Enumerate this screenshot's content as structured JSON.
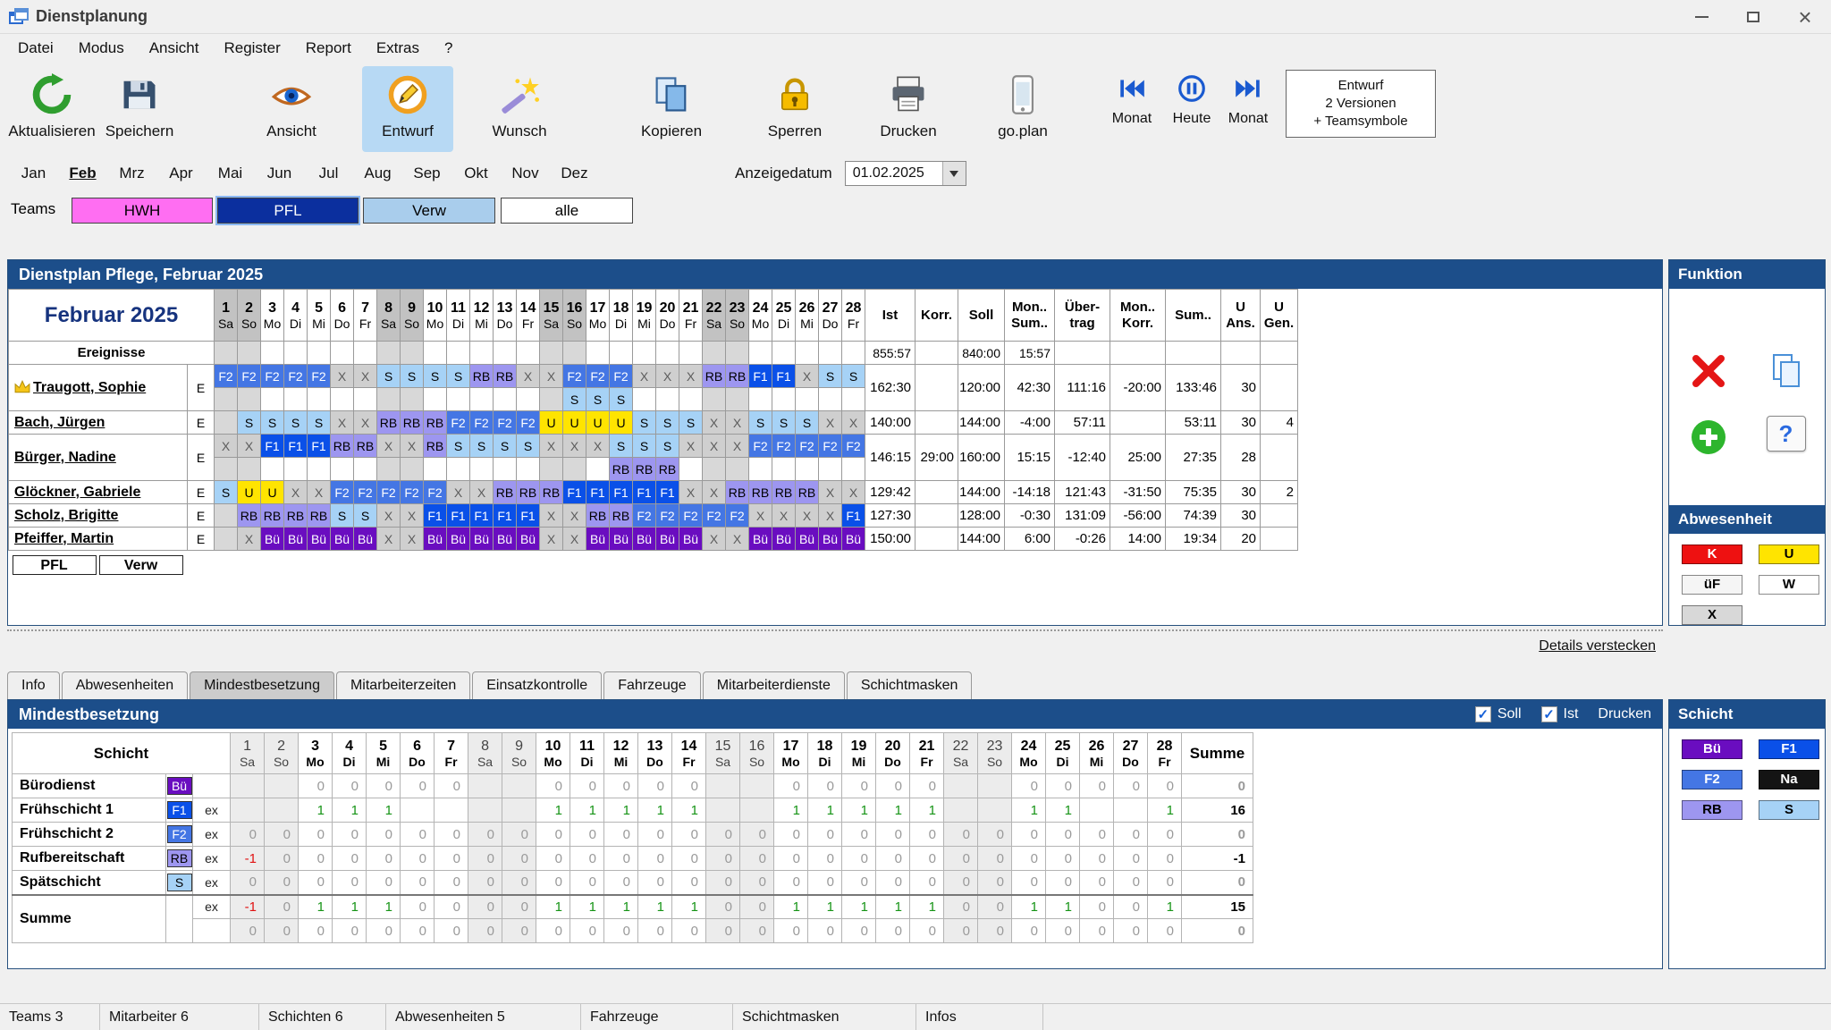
{
  "window": {
    "title": "Dienstplanung"
  },
  "menu": {
    "items": [
      "Datei",
      "Modus",
      "Ansicht",
      "Register",
      "Report",
      "Extras",
      "?"
    ]
  },
  "toolbar": {
    "buttons": [
      {
        "label": "Aktualisieren"
      },
      {
        "label": "Speichern"
      },
      {
        "label": "Ansicht"
      },
      {
        "label": "Entwurf",
        "active": true
      },
      {
        "label": "Wunsch"
      },
      {
        "label": "Kopieren"
      },
      {
        "label": "Sperren"
      },
      {
        "label": "Drucken"
      },
      {
        "label": "go.plan"
      }
    ],
    "nav": [
      {
        "label": "Monat"
      },
      {
        "label": "Heute"
      },
      {
        "label": "Monat"
      }
    ],
    "version_box": {
      "line1": "Entwurf",
      "line2": "2 Versionen",
      "line3": "+ Teamsymbole"
    }
  },
  "months": {
    "items": [
      "Jan",
      "Feb",
      "Mrz",
      "Apr",
      "Mai",
      "Jun",
      "Jul",
      "Aug",
      "Sep",
      "Okt",
      "Nov",
      "Dez"
    ],
    "active": "Feb",
    "anzeigedatum_label": "Anzeigedatum",
    "anzeigedatum_value": "01.02.2025"
  },
  "teams": {
    "label": "Teams",
    "buttons": [
      {
        "label": "HWH",
        "bg": "#ff6ef2",
        "fg": "#000000",
        "active": false
      },
      {
        "label": "PFL",
        "bg": "#0b2f9e",
        "fg": "#ffffff",
        "active": true
      },
      {
        "label": "Verw",
        "bg": "#a9cdec",
        "fg": "#000000",
        "active": false
      },
      {
        "label": "alle",
        "bg": "#ffffff",
        "fg": "#000000",
        "active": false
      }
    ]
  },
  "colors": {
    "header_blue": "#1c4e8a",
    "shift": {
      "F1": {
        "bg": "#0a50e8",
        "fg": "#ffffff"
      },
      "F2": {
        "bg": "#4476e4",
        "fg": "#ffffff"
      },
      "S": {
        "bg": "#a6d2f6",
        "fg": "#000000"
      },
      "RB": {
        "bg": "#9d96f0",
        "fg": "#000000"
      },
      "U": {
        "bg": "#ffe400",
        "fg": "#000000"
      },
      "Bü": {
        "bg": "#6a0dc0",
        "fg": "#ffffff"
      },
      "Na": {
        "bg": "#141414",
        "fg": "#ffffff"
      },
      "X": {
        "bg": "#cfcfcf",
        "fg": "#5c5c5c"
      }
    },
    "absence": {
      "K": {
        "bg": "#ee1111",
        "fg": "#ffffff"
      },
      "U": {
        "bg": "#ffe400",
        "fg": "#000000"
      },
      "üF": {
        "bg": "#f5f5f5",
        "fg": "#000000"
      },
      "W": {
        "bg": "#ffffff",
        "fg": "#000000"
      },
      "X": {
        "bg": "#d8d8d8",
        "fg": "#000000"
      }
    }
  },
  "schedule": {
    "title": "Dienstplan Pflege, Februar 2025",
    "month_label": "Februar 2025",
    "days": [
      {
        "n": "1",
        "d": "Sa"
      },
      {
        "n": "2",
        "d": "So"
      },
      {
        "n": "3",
        "d": "Mo"
      },
      {
        "n": "4",
        "d": "Di"
      },
      {
        "n": "5",
        "d": "Mi"
      },
      {
        "n": "6",
        "d": "Do"
      },
      {
        "n": "7",
        "d": "Fr"
      },
      {
        "n": "8",
        "d": "Sa"
      },
      {
        "n": "9",
        "d": "So"
      },
      {
        "n": "10",
        "d": "Mo"
      },
      {
        "n": "11",
        "d": "Di"
      },
      {
        "n": "12",
        "d": "Mi"
      },
      {
        "n": "13",
        "d": "Do"
      },
      {
        "n": "14",
        "d": "Fr"
      },
      {
        "n": "15",
        "d": "Sa"
      },
      {
        "n": "16",
        "d": "So"
      },
      {
        "n": "17",
        "d": "Mo"
      },
      {
        "n": "18",
        "d": "Di"
      },
      {
        "n": "19",
        "d": "Mi"
      },
      {
        "n": "20",
        "d": "Do"
      },
      {
        "n": "21",
        "d": "Fr"
      },
      {
        "n": "22",
        "d": "Sa"
      },
      {
        "n": "23",
        "d": "So"
      },
      {
        "n": "24",
        "d": "Mo"
      },
      {
        "n": "25",
        "d": "Di"
      },
      {
        "n": "26",
        "d": "Mi"
      },
      {
        "n": "27",
        "d": "Do"
      },
      {
        "n": "28",
        "d": "Fr"
      }
    ],
    "right_cols": [
      "Ist",
      "Korr.",
      "Soll",
      "Mon..\nSum..",
      "Über-\ntrag",
      "Mon..\nKorr.",
      "Sum..",
      "U\nAns.",
      "U\nGen."
    ],
    "ereignisse_label": "Ereignisse",
    "ereignisse_totals": [
      "855:57",
      "",
      "840:00",
      "15:57",
      "",
      "",
      "",
      "",
      ""
    ],
    "employees": [
      {
        "name": "Traugott, Sophie",
        "crown": true,
        "e": "E",
        "shifts": [
          "F2",
          "F2",
          "F2",
          "F2",
          "F2",
          "X",
          "X",
          "S",
          "S",
          "S",
          "S",
          "RB",
          "RB",
          "X",
          "X",
          "F2",
          "F2",
          "F2",
          "X",
          "X",
          "X",
          "RB",
          "RB",
          "F1",
          "F1",
          "X",
          "S",
          "S"
        ],
        "sub": [
          "",
          "",
          "",
          "",
          "",
          "",
          "",
          "",
          "",
          "",
          "",
          "",
          "",
          "",
          "",
          "S",
          "S",
          "S",
          "",
          "",
          "",
          "",
          "",
          "",
          "",
          "",
          "",
          ""
        ],
        "totals": [
          "162:30",
          "",
          "120:00",
          "42:30",
          "111:16",
          "-20:00",
          "133:46",
          "30",
          ""
        ]
      },
      {
        "name": "Bach, Jürgen",
        "crown": false,
        "e": "E",
        "shifts": [
          "",
          "S",
          "S",
          "S",
          "S",
          "X",
          "X",
          "RB",
          "RB",
          "RB",
          "F2",
          "F2",
          "F2",
          "F2",
          "U",
          "U",
          "U",
          "U",
          "S",
          "S",
          "S",
          "X",
          "X",
          "S",
          "S",
          "S",
          "X",
          "X"
        ],
        "totals": [
          "140:00",
          "",
          "144:00",
          "-4:00",
          "57:11",
          "",
          "53:11",
          "30",
          "4"
        ]
      },
      {
        "name": "Bürger, Nadine",
        "crown": false,
        "e": "E",
        "shifts": [
          "X",
          "X",
          "F1",
          "F1",
          "F1",
          "RB",
          "RB",
          "X",
          "X",
          "RB",
          "S",
          "S",
          "S",
          "S",
          "X",
          "X",
          "X",
          "S",
          "S",
          "S",
          "X",
          "X",
          "X",
          "F2",
          "F2",
          "F2",
          "F2",
          "F2"
        ],
        "sub": [
          "",
          "",
          "",
          "",
          "",
          "",
          "",
          "",
          "",
          "",
          "",
          "",
          "",
          "",
          "",
          "",
          "",
          "RB",
          "RB",
          "RB",
          "",
          "",
          "",
          "",
          "",
          "",
          "",
          ""
        ],
        "totals": [
          "146:15",
          "29:00",
          "160:00",
          "15:15",
          "-12:40",
          "25:00",
          "27:35",
          "28",
          ""
        ]
      },
      {
        "name": "Glöckner, Gabriele",
        "crown": false,
        "e": "E",
        "shifts": [
          "S",
          "U",
          "U",
          "X",
          "X",
          "F2",
          "F2",
          "F2",
          "F2",
          "F2",
          "X",
          "X",
          "RB",
          "RB",
          "RB",
          "F1",
          "F1",
          "F1",
          "F1",
          "F1",
          "X",
          "X",
          "RB",
          "RB",
          "RB",
          "RB",
          "X",
          "X"
        ],
        "totals": [
          "129:42",
          "",
          "144:00",
          "-14:18",
          "121:43",
          "-31:50",
          "75:35",
          "30",
          "2"
        ]
      },
      {
        "name": "Scholz, Brigitte",
        "crown": false,
        "e": "E",
        "shifts": [
          "",
          "RB",
          "RB",
          "RB",
          "RB",
          "S",
          "S",
          "X",
          "X",
          "F1",
          "F1",
          "F1",
          "F1",
          "F1",
          "X",
          "X",
          "RB",
          "RB",
          "F2",
          "F2",
          "F2",
          "F2",
          "F2",
          "X",
          "X",
          "X",
          "X",
          "F1"
        ],
        "totals": [
          "127:30",
          "",
          "128:00",
          "-0:30",
          "131:09",
          "-56:00",
          "74:39",
          "30",
          ""
        ]
      },
      {
        "name": "Pfeiffer, Martin",
        "crown": false,
        "e": "E",
        "shifts": [
          "",
          "X",
          "Bü",
          "Bü",
          "Bü",
          "Bü",
          "Bü",
          "X",
          "X",
          "Bü",
          "Bü",
          "Bü",
          "Bü",
          "Bü",
          "X",
          "X",
          "Bü",
          "Bü",
          "Bü",
          "Bü",
          "Bü",
          "X",
          "X",
          "Bü",
          "Bü",
          "Bü",
          "Bü",
          "Bü"
        ],
        "totals": [
          "150:00",
          "",
          "144:00",
          "6:00",
          "-0:26",
          "14:00",
          "19:34",
          "20",
          ""
        ]
      }
    ],
    "footer_buttons": [
      "PFL",
      "Verw"
    ]
  },
  "details_link": "Details verstecken",
  "tabs": {
    "items": [
      "Info",
      "Abwesenheiten",
      "Mindestbesetzung",
      "Mitarbeiterzeiten",
      "Einsatzkontrolle",
      "Fahrzeuge",
      "Mitarbeiterdienste",
      "Schichtmasken"
    ],
    "active": "Mindestbesetzung"
  },
  "mindest": {
    "title": "Mindestbesetzung",
    "soll_label": "Soll",
    "ist_label": "Ist",
    "drucken_label": "Drucken",
    "schicht_col": "Schicht",
    "summe_col": "Summe",
    "rows": [
      {
        "label": "Bürodienst",
        "badge": "Bü",
        "ex": "",
        "values": [
          "",
          "",
          "0",
          "0",
          "0",
          "0",
          "0",
          "",
          "",
          "0",
          "0",
          "0",
          "0",
          "0",
          "",
          "",
          "0",
          "0",
          "0",
          "0",
          "0",
          "",
          "",
          "0",
          "0",
          "0",
          "0",
          "0"
        ],
        "summe": "0"
      },
      {
        "label": "Frühschicht 1",
        "badge": "F1",
        "ex": "ex",
        "values": [
          "",
          "",
          "1",
          "1",
          "1",
          "",
          "",
          "",
          "",
          "1",
          "1",
          "1",
          "1",
          "1",
          "",
          "",
          "1",
          "1",
          "1",
          "1",
          "1",
          "",
          "",
          "1",
          "1",
          "",
          "",
          "1"
        ],
        "summe": "16"
      },
      {
        "label": "Frühschicht 2",
        "badge": "F2",
        "ex": "ex",
        "values": [
          "0",
          "0",
          "0",
          "0",
          "0",
          "0",
          "0",
          "0",
          "0",
          "0",
          "0",
          "0",
          "0",
          "0",
          "0",
          "0",
          "0",
          "0",
          "0",
          "0",
          "0",
          "0",
          "0",
          "0",
          "0",
          "0",
          "0",
          "0"
        ],
        "summe": "0"
      },
      {
        "label": "Rufbereitschaft",
        "badge": "RB",
        "ex": "ex",
        "values": [
          "-1",
          "0",
          "0",
          "0",
          "0",
          "0",
          "0",
          "0",
          "0",
          "0",
          "0",
          "0",
          "0",
          "0",
          "0",
          "0",
          "0",
          "0",
          "0",
          "0",
          "0",
          "0",
          "0",
          "0",
          "0",
          "0",
          "0",
          "0"
        ],
        "summe": "-1"
      },
      {
        "label": "Spätschicht",
        "badge": "S",
        "ex": "ex",
        "values": [
          "0",
          "0",
          "0",
          "0",
          "0",
          "0",
          "0",
          "0",
          "0",
          "0",
          "0",
          "0",
          "0",
          "0",
          "0",
          "0",
          "0",
          "0",
          "0",
          "0",
          "0",
          "0",
          "0",
          "0",
          "0",
          "0",
          "0",
          "0"
        ],
        "summe": "0"
      }
    ],
    "summe_row": {
      "label": "Summe",
      "ex": "ex",
      "values1": [
        "-1",
        "0",
        "1",
        "1",
        "1",
        "0",
        "0",
        "0",
        "0",
        "1",
        "1",
        "1",
        "1",
        "1",
        "0",
        "0",
        "1",
        "1",
        "1",
        "1",
        "1",
        "0",
        "0",
        "1",
        "1",
        "0",
        "0",
        "1"
      ],
      "summe1": "15",
      "values2": [
        "0",
        "0",
        "0",
        "0",
        "0",
        "0",
        "0",
        "0",
        "0",
        "0",
        "0",
        "0",
        "0",
        "0",
        "0",
        "0",
        "0",
        "0",
        "0",
        "0",
        "0",
        "0",
        "0",
        "0",
        "0",
        "0",
        "0",
        "0"
      ],
      "summe2": "0"
    }
  },
  "side": {
    "funktion": {
      "title": "Funktion",
      "help_label": "?"
    },
    "abwesenheit": {
      "title": "Abwesenheit",
      "items": [
        "K",
        "U",
        "üF",
        "W",
        "X"
      ]
    },
    "schicht": {
      "title": "Schicht",
      "items": [
        "Bü",
        "F1",
        "F2",
        "Na",
        "RB",
        "S"
      ]
    }
  },
  "statusbar": {
    "items": [
      "Teams 3",
      "Mitarbeiter 6",
      "Schichten 6",
      "Abwesenheiten 5",
      "Fahrzeuge",
      "Schichtmasken",
      "Infos"
    ]
  }
}
